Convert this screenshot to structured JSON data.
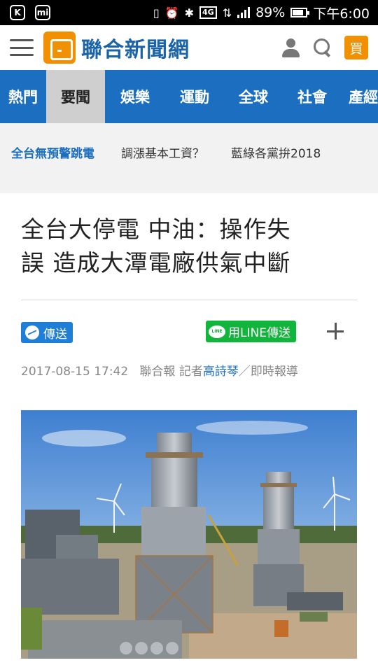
{
  "status_bar": {
    "battery": "89%",
    "network": "4G",
    "time": "下午6:00"
  },
  "header": {
    "site_name": "聯合新聞網",
    "buy_label": "買"
  },
  "categories": [
    {
      "label": "熱門",
      "active": false
    },
    {
      "label": "要聞",
      "active": true
    },
    {
      "label": "娛樂",
      "active": false
    },
    {
      "label": "運動",
      "active": false
    },
    {
      "label": "全球",
      "active": false
    },
    {
      "label": "社會",
      "active": false
    },
    {
      "label": "產經",
      "active": false
    }
  ],
  "topics": [
    {
      "label": "全台無預警跳電",
      "active": true
    },
    {
      "label": "調漲基本工資？",
      "active": false
    },
    {
      "label": "藍綠各黨拚2018",
      "active": false
    }
  ],
  "article": {
    "headline_line1": "全台大停電 中油：操作失",
    "headline_line2": "誤 造成大潭電廠供氣中斷",
    "share_messenger_label": "傳送",
    "share_line_label": "用LINE傳送",
    "datetime": "2017-08-15 17:42",
    "source": "聯合報 記者",
    "reporter": "高詩琴",
    "byline_suffix": "／即時報導"
  },
  "colors": {
    "brand_blue": "#1c6fc0",
    "brand_orange": "#f19000",
    "line_green": "#12b53b",
    "messenger_blue": "#1f7fd6"
  }
}
